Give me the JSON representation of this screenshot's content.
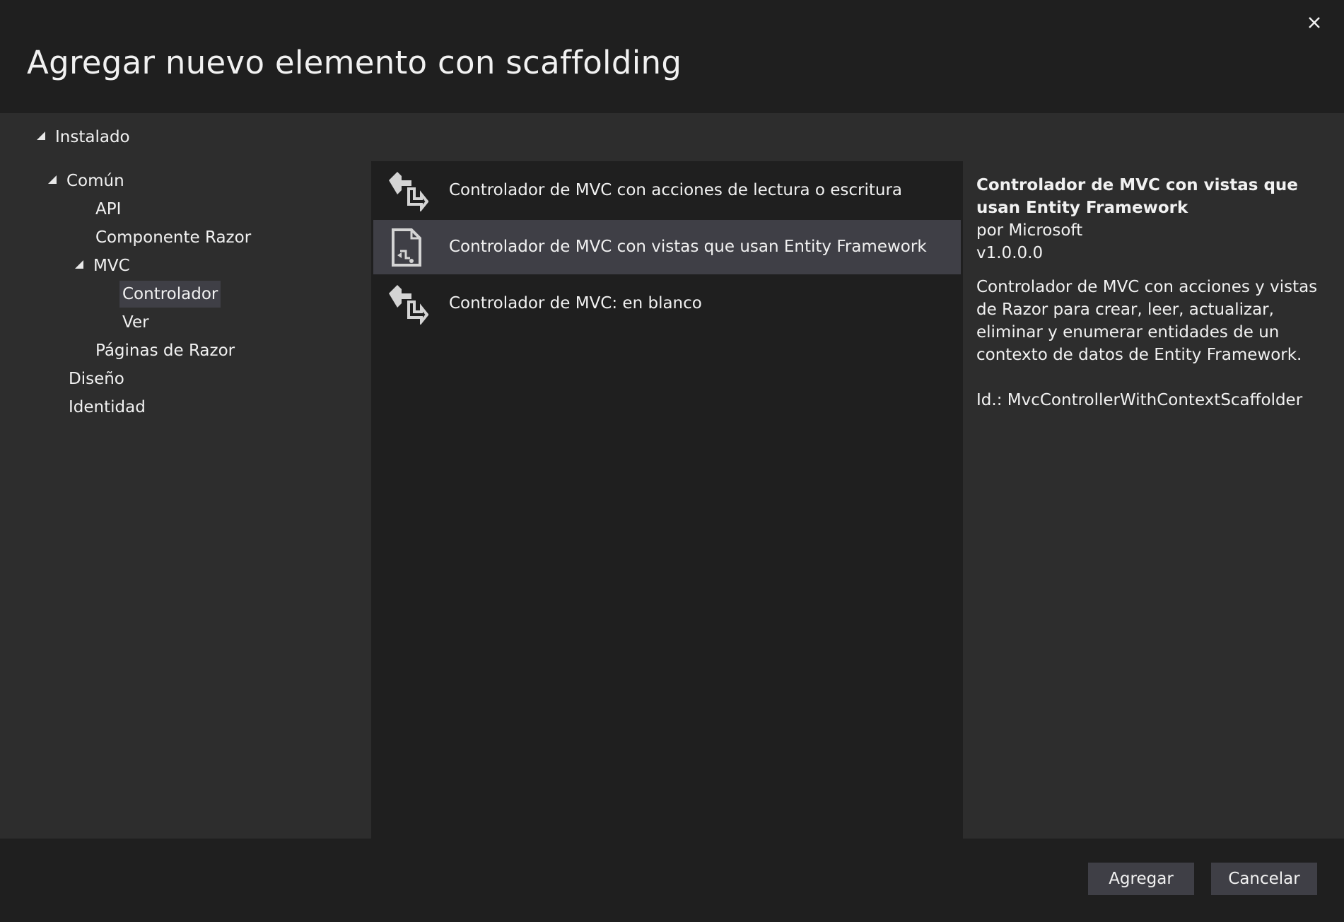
{
  "dialog": {
    "title": "Agregar nuevo elemento con scaffolding",
    "close_icon": "close-icon"
  },
  "tree": {
    "root": "Instalado",
    "comun": "Común",
    "api": "API",
    "componente_razor": "Componente Razor",
    "mvc": "MVC",
    "controlador": "Controlador",
    "ver": "Ver",
    "paginas_razor": "Páginas de Razor",
    "diseno": "Diseño",
    "identidad": "Identidad"
  },
  "list": {
    "items": [
      {
        "label": "Controlador de MVC con acciones de lectura o escritura",
        "icon": "controller-icon"
      },
      {
        "label": "Controlador de MVC con vistas que usan Entity Framework",
        "icon": "controller-views-icon",
        "selected": true
      },
      {
        "label": "Controlador de MVC: en blanco",
        "icon": "controller-icon"
      }
    ]
  },
  "details": {
    "title": "Controlador de MVC con vistas que usan Entity Framework",
    "author": "por Microsoft",
    "version": "v1.0.0.0",
    "description": "Controlador de MVC con acciones y vistas de Razor para crear, leer, actualizar, eliminar y enumerar entidades de un contexto de datos de Entity Framework.",
    "id": "Id.: MvcControllerWithContextScaffolder"
  },
  "footer": {
    "add_label": "Agregar",
    "cancel_label": "Cancelar"
  },
  "colors": {
    "background": "#1f1f1f",
    "panel": "#2d2d2d",
    "selection": "#3f3f46",
    "text": "#f1f1f1"
  }
}
